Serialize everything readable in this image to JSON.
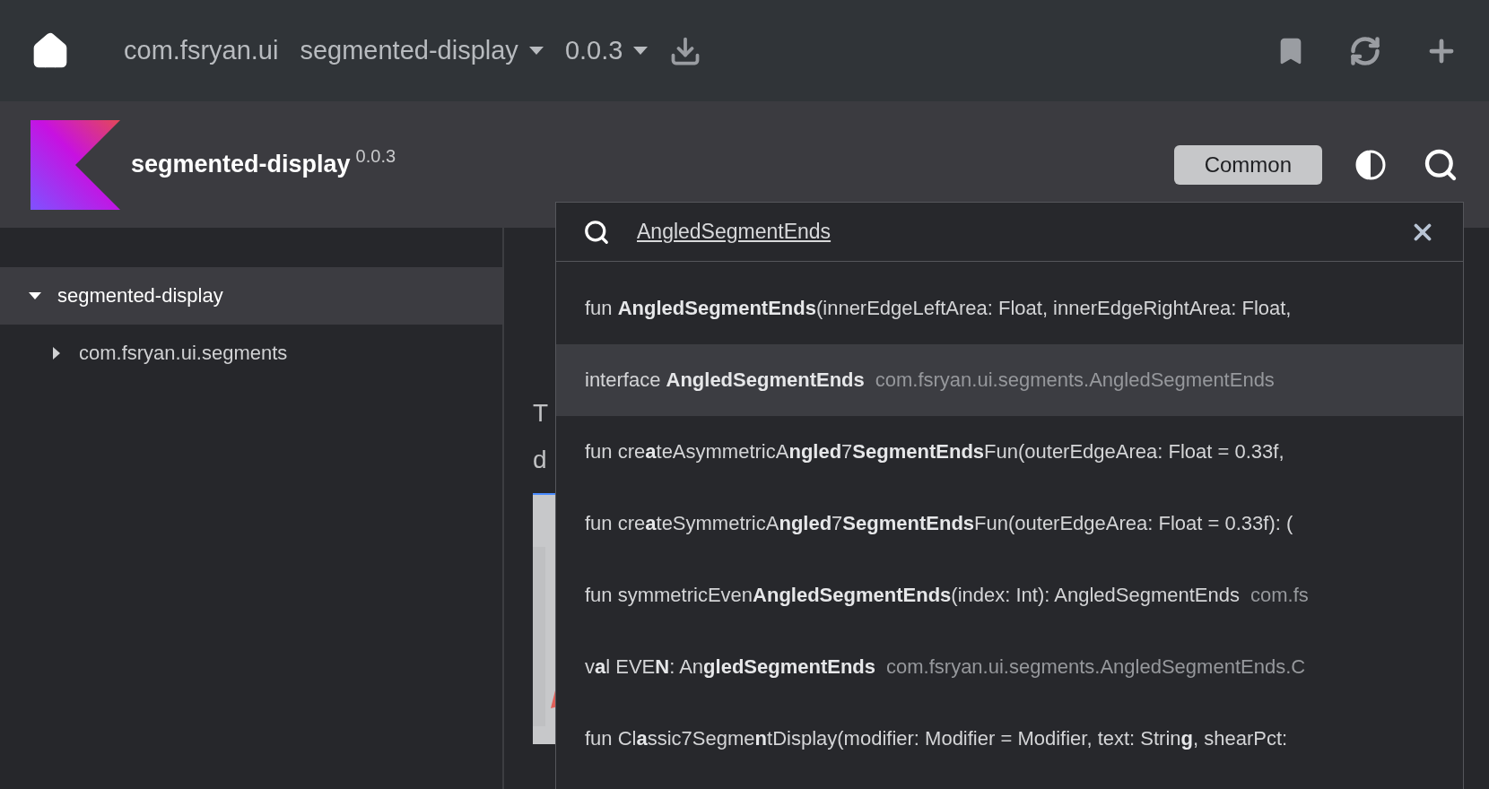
{
  "top_bar": {
    "breadcrumbs": [
      {
        "label": "com.fsryan.ui",
        "dropdown": false
      },
      {
        "label": "segmented-display",
        "dropdown": true
      },
      {
        "label": "0.0.3",
        "dropdown": true
      }
    ]
  },
  "header": {
    "title": "segmented-display",
    "version": "0.0.3",
    "platform_button": "Common"
  },
  "sidebar": {
    "items": [
      {
        "label": "segmented-display",
        "selected": true,
        "expanded": true,
        "children": [
          {
            "label": "com.fsryan.ui.segments",
            "selected": false,
            "expanded": false
          }
        ]
      }
    ]
  },
  "main": {
    "lines": [
      "T",
      "d"
    ],
    "figure": {
      "kind": "picture"
    }
  },
  "search": {
    "value": "AngledSegmentEnds",
    "results": [
      {
        "signature": "fun **AngledSegmentEnds**(innerEdgeLeftArea: Float, innerEdgeRightArea: Float,",
        "selected": false
      },
      {
        "signature": "interface **AngledSegmentEnds**",
        "location": "com.fsryan.ui.segments.AngledSegmentEnds",
        "selected": true
      },
      {
        "signature": "fun cre**a**teAsymmetricA**ngled**7**SegmentEnds**Fun(outerEdgeArea: Float = 0.33f,",
        "selected": false
      },
      {
        "signature": "fun cre**a**teSymmetricA**ngled**7**SegmentEnds**Fun(outerEdgeArea: Float = 0.33f): (",
        "selected": false
      },
      {
        "signature": "fun symmetricEven**AngledSegmentEnds**(index: Int): AngledSegmentEnds",
        "location": "com.fs",
        "selected": false
      },
      {
        "signature": "v**a**l EVE**N**: An**gledSegmentEnds**",
        "location": "com.fsryan.ui.segments.AngledSegmentEnds.C",
        "selected": false
      },
      {
        "signature": "fun Cl**a**ssic7Segme**n**tDisplay(modifier: Modifier = Modifier, text: Strin**g**, shearPct:",
        "selected": false
      }
    ]
  }
}
